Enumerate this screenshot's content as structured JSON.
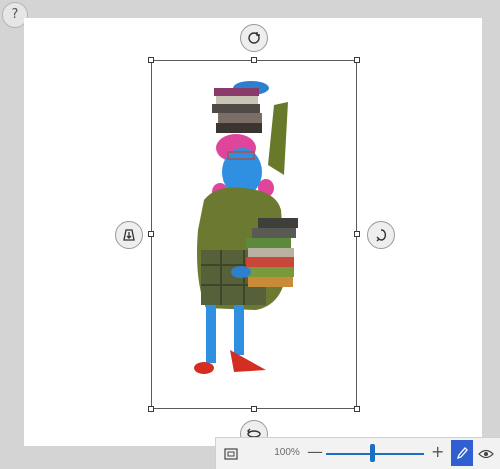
{
  "help": {
    "label": "?"
  },
  "toolbar": {
    "zoom_label": "100%",
    "zoom_minus": "—",
    "zoom_plus": "+",
    "zoom_level": 0.47
  },
  "icons": {
    "help": "question-mark",
    "rotate_top": "rotate-icon",
    "rotate_left": "tilt-icon",
    "rotate_right": "rotate-side-icon",
    "rotate_bottom": "rotate-horizontal-icon",
    "fit": "fit-to-screen-icon",
    "pen": "pen-icon",
    "eye": "eye-icon"
  },
  "colors": {
    "accent": "#1a6fc4",
    "pen_active": "#2f5fd0"
  }
}
